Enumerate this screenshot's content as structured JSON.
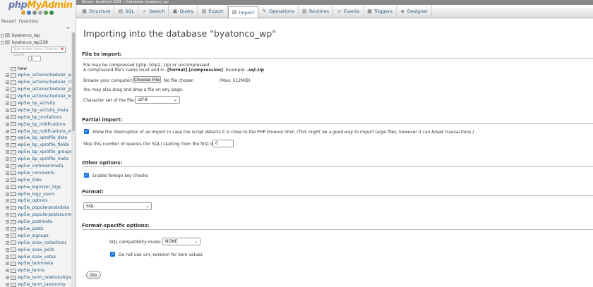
{
  "nav": {
    "logo_php": "php",
    "logo_admin": "MyAdmin",
    "recent": "Recent",
    "favorites": "Favorites",
    "collapse_icon": "link-chain-icon",
    "db1": "byatonco_wp",
    "db2": "byatonco_wp136",
    "filter_placeholder": "Type to filter these, Enter to search",
    "filter_clear": "X",
    "page_select": "1",
    "page_next": "> >>",
    "new_label": "New",
    "tables": [
      "wp5w_actionscheduler_ac",
      "wp5w_actionscheduler_cla",
      "wp5w_actionscheduler_gr",
      "wp5w_actionscheduler_log",
      "wp5w_bp_activity",
      "wp5w_bp_activity_meta",
      "wp5w_bp_invitations",
      "wp5w_bp_notifications",
      "wp5w_bp_notifications_me",
      "wp5w_bp_xprofile_data",
      "wp5w_bp_xprofile_fields",
      "wp5w_bp_xprofile_groups",
      "wp5w_bp_xprofile_meta",
      "wp5w_commentmeta",
      "wp5w_comments",
      "wp5w_links",
      "wp5w_loginizer_logs",
      "wp5w_logy_users",
      "wp5w_options",
      "wp5w_popularpostsdata",
      "wp5w_popularpostssumm",
      "wp5w_postmeta",
      "wp5w_posts",
      "wp5w_signups",
      "wp5w_snax_collections",
      "wp5w_snax_polls",
      "wp5w_snax_votes",
      "wp5w_termmeta",
      "wp5w_terms",
      "wp5w_term_relationships",
      "wp5w_term_taxonomy"
    ]
  },
  "breadcrumb": "Server: localhost:3306 » Database: byatonco_wp",
  "tabs": [
    {
      "label": "Structure",
      "icon": "▦"
    },
    {
      "label": "SQL",
      "icon": "▤"
    },
    {
      "label": "Search",
      "icon": "⌕"
    },
    {
      "label": "Query",
      "icon": "▣"
    },
    {
      "label": "Export",
      "icon": "▥"
    },
    {
      "label": "Import",
      "icon": "▧"
    },
    {
      "label": "Operations",
      "icon": "✎"
    },
    {
      "label": "Routines",
      "icon": "▨"
    },
    {
      "label": "Events",
      "icon": "⦸"
    },
    {
      "label": "Triggers",
      "icon": "▩"
    },
    {
      "label": "Designer",
      "icon": "◈"
    }
  ],
  "main": {
    "title": "Importing into the database \"byatonco_wp\"",
    "file_section": "File to import:",
    "compress_line1": "File may be compressed (gzip, bzip2, zip) or uncompressed.",
    "compress_line2_a": "A compressed file's name must end in ",
    "compress_line2_b": ".[format].[compression]",
    "compress_line2_c": ". Example: ",
    "compress_line2_d": ".sql.zip",
    "browse_label": "Browse your computer:",
    "choose_file": "Choose File",
    "no_file": "No file chosen",
    "max_size": "(Max: 512MiB)",
    "drag_drop": "You may also drag and drop a file on any page.",
    "charset_label": "Character set of the file:",
    "charset_value": "utf-8",
    "partial_section": "Partial import:",
    "allow_interrupt": "Allow the interruption of an import in case the script detects it is close to the PHP timeout limit.",
    "allow_interrupt_note": "(This might be a good way to import large files, however it can break transactions.)",
    "skip_label": "Skip this number of queries (for SQL) starting from the first one:",
    "skip_value": "0",
    "other_section": "Other options:",
    "foreign_keys": "Enable foreign key checks",
    "format_section": "Format:",
    "format_value": "SQL",
    "format_specific_section": "Format-specific options:",
    "sql_compat_label": "SQL compatibility mode:",
    "sql_compat_value": "NONE",
    "no_auto_inc_a": "Do not use ",
    "no_auto_inc_b": "AUTO_INCREMENT",
    "no_auto_inc_c": " for zero values",
    "go": "Go"
  }
}
